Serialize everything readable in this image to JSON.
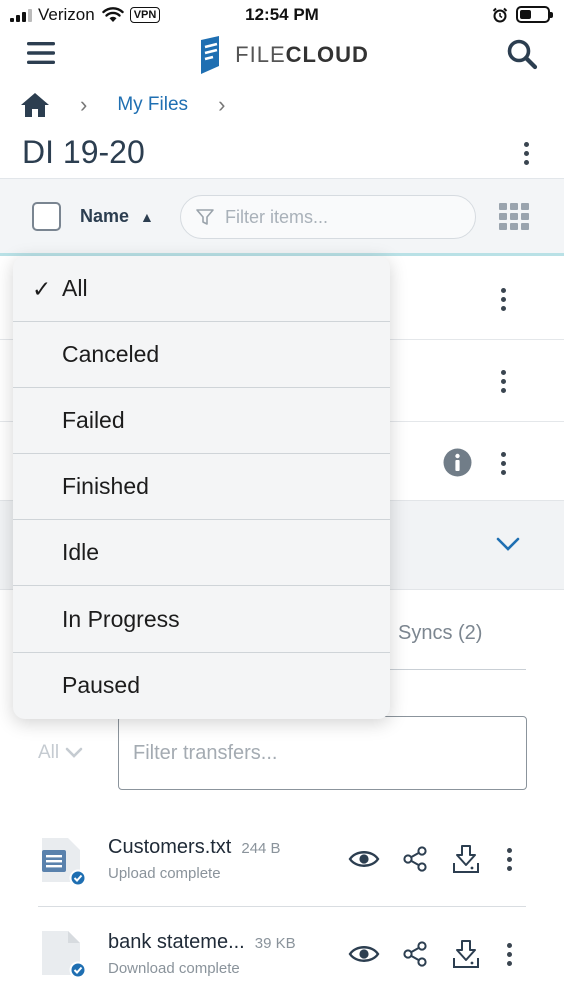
{
  "status_bar": {
    "carrier": "Verizon",
    "vpn": "VPN",
    "time": "12:54 PM"
  },
  "header": {
    "brand_file": "FILE",
    "brand_cloud": "CLOUD"
  },
  "breadcrumb": {
    "current": "My Files"
  },
  "page": {
    "title": "DI 19-20"
  },
  "toolbar": {
    "sort_label": "Name",
    "filter_placeholder": "Filter items..."
  },
  "status_filter_menu": {
    "selected": "All",
    "options": [
      "All",
      "Canceled",
      "Failed",
      "Finished",
      "Idle",
      "In Progress",
      "Paused"
    ]
  },
  "transfers": {
    "syncs_tab": "Syncs (2)",
    "status_select": "All",
    "filter_placeholder": "Filter transfers...",
    "items": [
      {
        "name": "Customers.txt",
        "size": "244 B",
        "status": "Upload complete"
      },
      {
        "name": "bank stateme...",
        "size": "39 KB",
        "status": "Download complete"
      }
    ]
  },
  "colors": {
    "accent": "#1f6fb2",
    "check_badge": "#1f6fb2",
    "toolbar_underline": "#b9e1e6"
  }
}
